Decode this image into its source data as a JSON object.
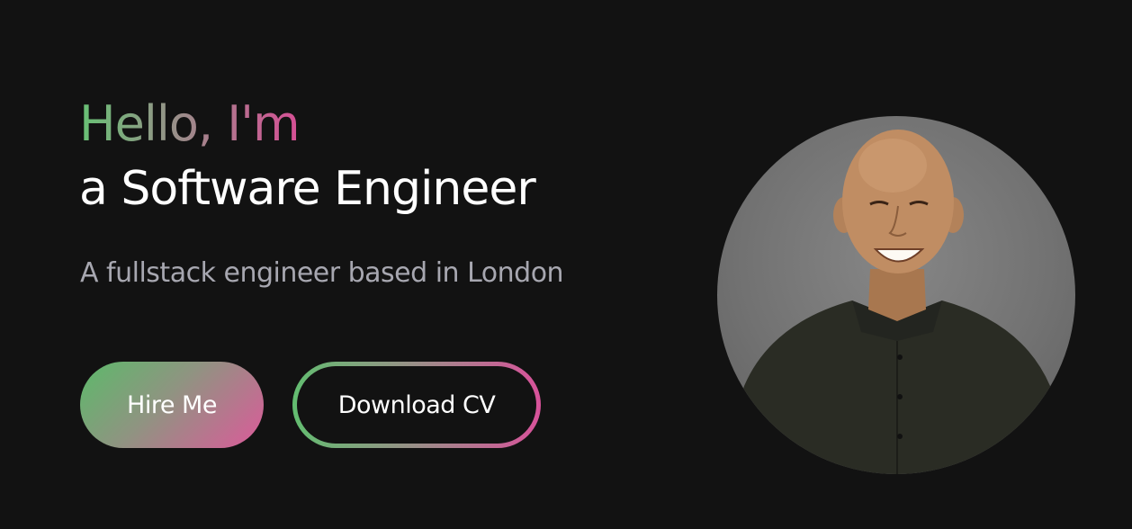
{
  "hero": {
    "greeting": "Hello, I'm",
    "role": "a Software Engineer",
    "subtitle": "A fullstack engineer based in London",
    "hire_label": "Hire Me",
    "cv_label": "Download CV"
  },
  "colors": {
    "background": "#121212",
    "gradient_start": "#67c174",
    "gradient_end": "#d64f95",
    "subtitle": "#a7a7b0"
  },
  "profile_photo": {
    "icon": "avatar-photo"
  }
}
